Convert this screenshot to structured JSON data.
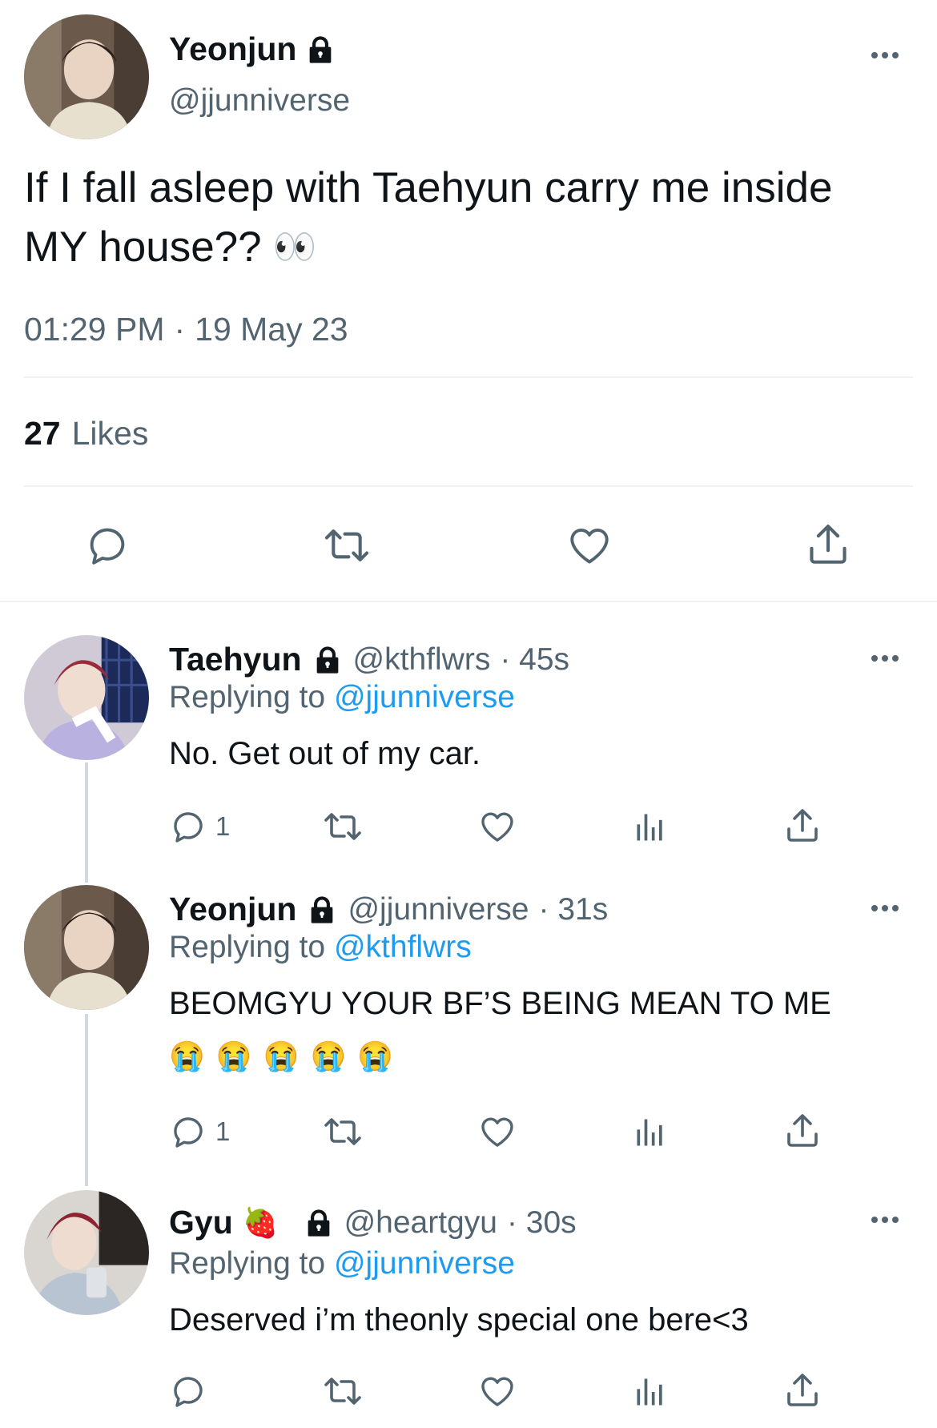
{
  "main_tweet": {
    "name": "Yeonjun",
    "handle": "@jjunniverse",
    "text_line1": "If I fall asleep with Taehyun carry me inside",
    "text_line2": "MY house??",
    "emoji": "👀",
    "time": "01:29 PM",
    "separator": "·",
    "date": "19 May 23",
    "likes_count": "27",
    "likes_label": "Likes"
  },
  "replies": [
    {
      "name": "Taehyun",
      "handle": "@kthflwrs",
      "time": "· 45s",
      "replying_label": "Replying to",
      "replying_handle": "@jjunniverse",
      "text": "No. Get out of my car.",
      "reply_count": "1"
    },
    {
      "name": "Yeonjun",
      "handle": "@jjunniverse",
      "time": "· 31s",
      "replying_label": "Replying to",
      "replying_handle": "@kthflwrs",
      "text": "BEOMGYU YOUR BF’S BEING MEAN TO ME",
      "emoji_line": "😭 😭 😭 😭 😭",
      "reply_count": "1"
    },
    {
      "name": "Gyu",
      "name_emoji": "🍓",
      "handle": "@heartgyu",
      "time": "· 30s",
      "replying_label": "Replying to",
      "replying_handle": "@jjunniverse",
      "text": "Deserved i’m theonly special one bere<3"
    }
  ],
  "icons": {
    "lock": "lock-icon",
    "more": "more-icon",
    "reply": "reply-icon",
    "retweet": "retweet-icon",
    "like": "heart-icon",
    "share": "share-icon",
    "views": "views-icon"
  },
  "colors": {
    "text": "#0f1419",
    "secondary": "#536471",
    "link": "#1d9bf0",
    "divider": "#eff3f4"
  }
}
